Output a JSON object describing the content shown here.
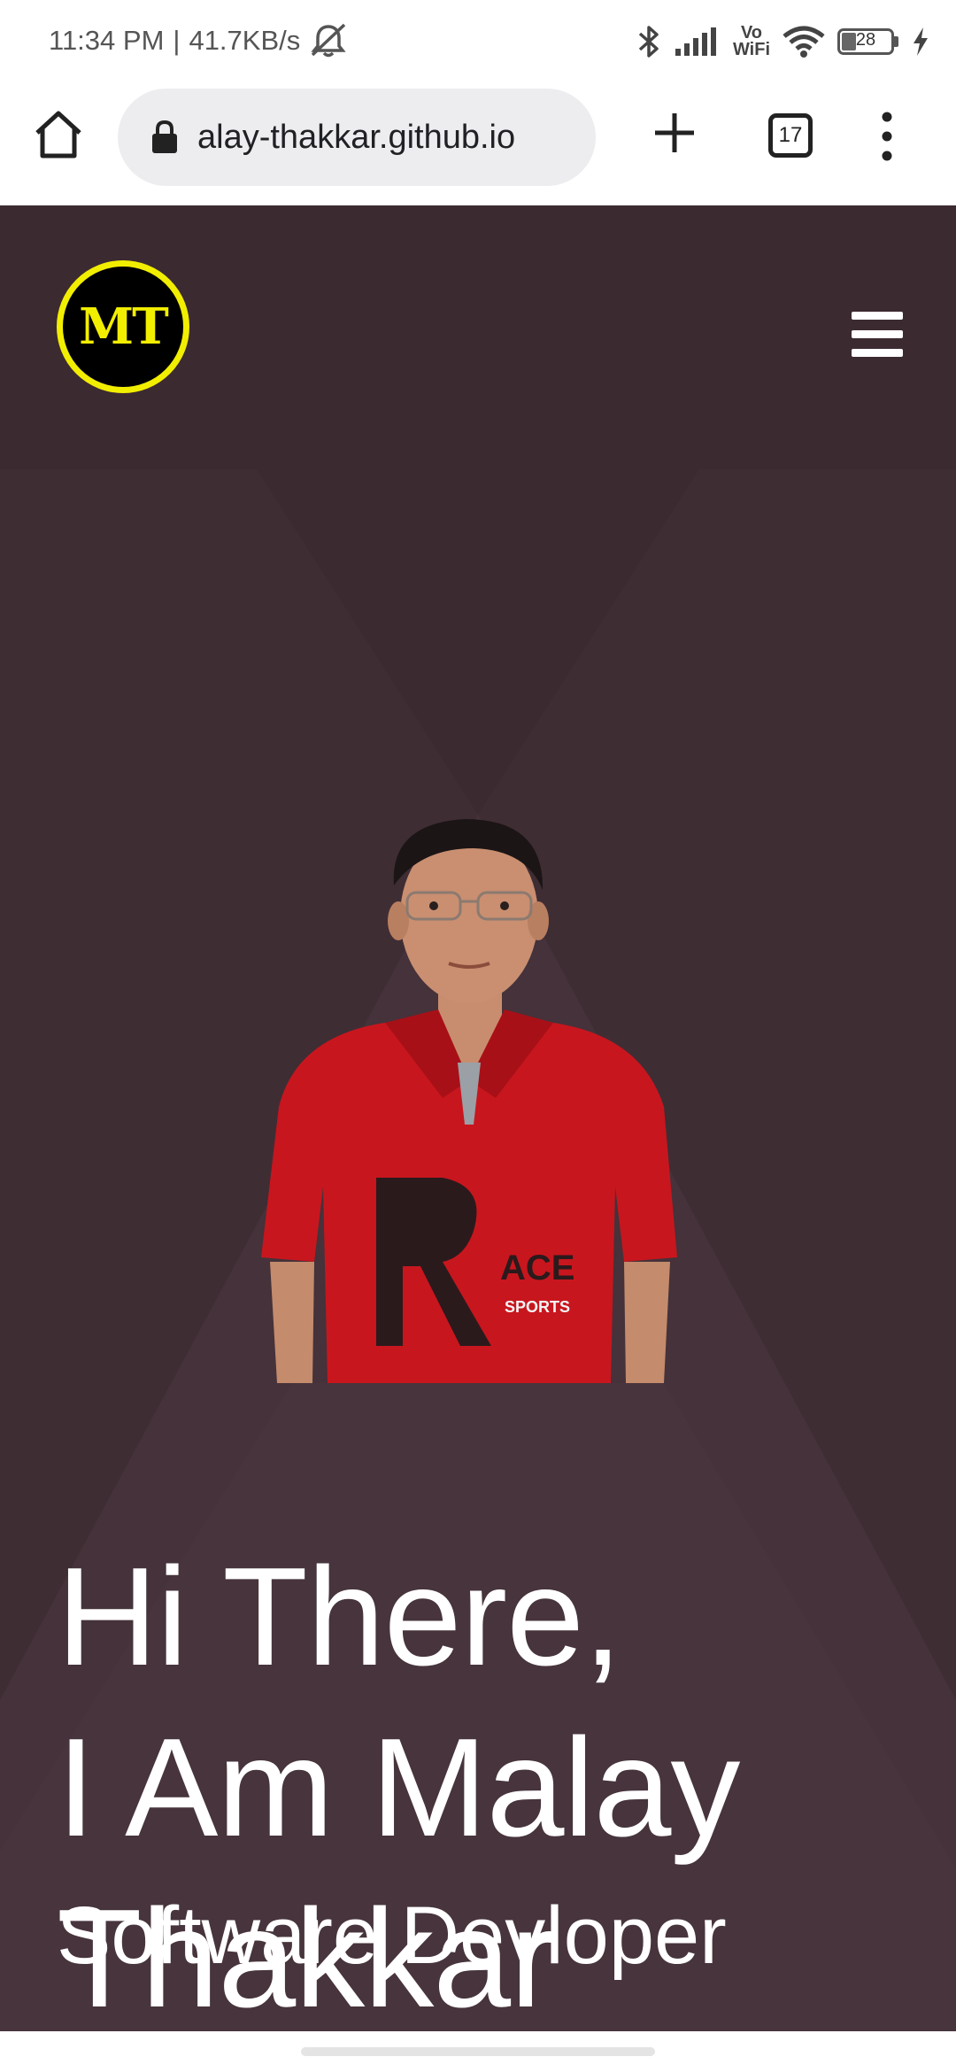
{
  "status_bar": {
    "time": "11:34 PM",
    "separator": "|",
    "network_speed": "41.7KB/s",
    "battery_level": "28",
    "icons": [
      "muted-bell-icon",
      "bluetooth-icon",
      "signal-icon",
      "vowifi-icon",
      "wifi-icon",
      "battery-icon",
      "charging-icon"
    ],
    "vowifi_top": "Vo",
    "vowifi_bottom": "WiFi"
  },
  "browser": {
    "url": "alay-thakkar.github.io",
    "tab_count": "17"
  },
  "site": {
    "logo_text": "MT",
    "brand_color": "#f2ee00",
    "header_color": "#3c2a31",
    "hero_color": "#45323a"
  },
  "hero": {
    "greeting_lines": [
      "Hi There,",
      "I Am Malay",
      "Thakkar"
    ],
    "role": "Software Devloper"
  }
}
